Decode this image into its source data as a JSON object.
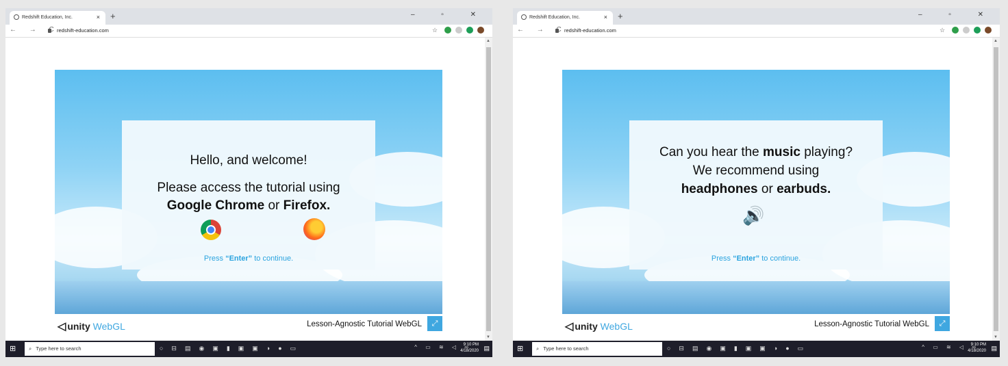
{
  "left": {
    "browser": {
      "tab_title": "Redshift Education, Inc.",
      "tab_close": "×",
      "new_tab": "+",
      "window_controls": "– ▫ ✕",
      "nav": "← → C",
      "url": "redshift-education.com"
    },
    "game": {
      "line1": "Hello, and welcome!",
      "line2": "Please access the tutorial using",
      "line3_b1": "Google Chrome",
      "line3_or": "or",
      "line3_b2": "Firefox.",
      "press_pre": "Press",
      "press_key": "“Enter”",
      "press_post": "to continue."
    },
    "footer": {
      "unity": "unity",
      "webgl": "WebGL",
      "title": "Lesson-Agnostic Tutorial WebGL",
      "fullscreen": "⤢"
    },
    "taskbar": {
      "search_placeholder": "Type here to search",
      "time": "9:10 PM",
      "date": "4/18/2020"
    }
  },
  "right": {
    "browser": {
      "tab_title": "Redshift Education, Inc.",
      "tab_close": "×",
      "new_tab": "+",
      "window_controls": "– ▫ ✕",
      "nav": "← → C",
      "url": "redshift-education.com"
    },
    "game": {
      "line1_pre": "Can you hear the",
      "line1_b": "music",
      "line1_post": "playing?",
      "line2": "We recommend using",
      "line3_b1": "headphones",
      "line3_or": "or",
      "line3_b2": "earbuds.",
      "press_pre": "Press",
      "press_key": "“Enter”",
      "press_post": "to continue."
    },
    "footer": {
      "unity": "unity",
      "webgl": "WebGL",
      "title": "Lesson-Agnostic Tutorial WebGL",
      "fullscreen": "⤢"
    },
    "taskbar": {
      "search_placeholder": "Type here to search",
      "time": "9:10 PM",
      "date": "4/18/2020"
    }
  },
  "colors": {
    "accent_blue": "#3fa7e0",
    "taskbar": "#1e1e2a"
  }
}
